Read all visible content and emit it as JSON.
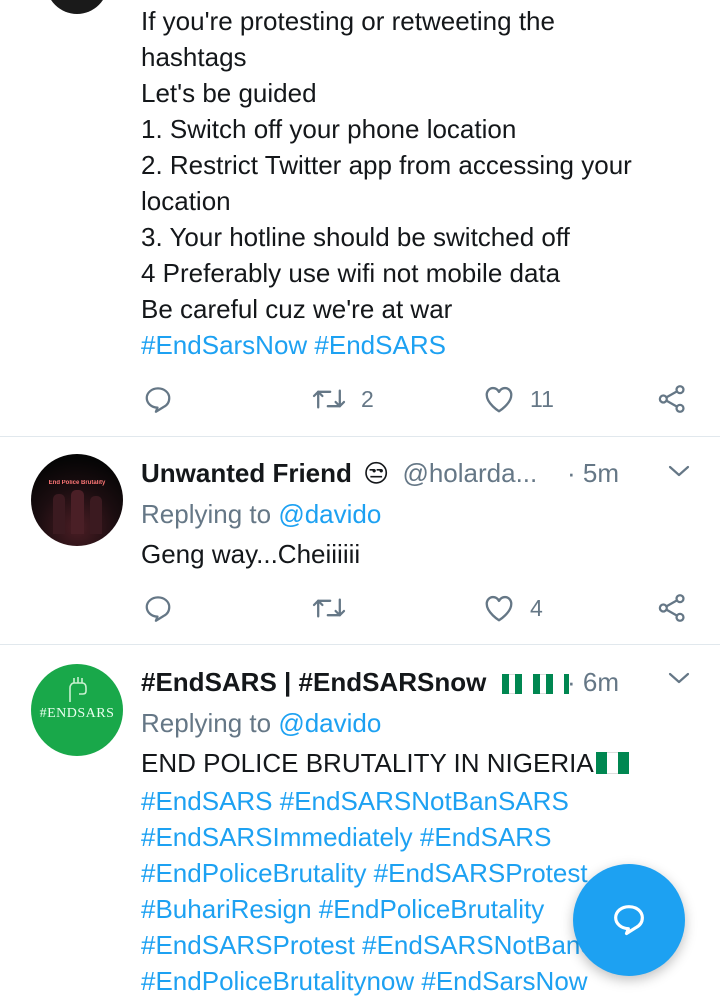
{
  "tweet1": {
    "lines": [
      "If you're protesting or retweeting the",
      "hashtags",
      "Let's be guided",
      "1. Switch off your phone location",
      "2. Restrict Twitter app from accessing your",
      "location",
      "3. Your hotline should be switched off",
      "4 Preferably use wifi not mobile data",
      "Be careful cuz we're at war"
    ],
    "hashtags": "#EndSarsNow #EndSARS",
    "retweets": "2",
    "likes": "11"
  },
  "tweet2": {
    "display_name": "Unwanted Friend",
    "emoji": "😒",
    "username": "@holarda...",
    "time": "· 5m",
    "replying_prefix": "Replying to",
    "replying_handle": "@davido",
    "text": "Geng way...Cheiiiiii",
    "retweets": "",
    "likes": "4",
    "avatar_text": "End Police Brutality"
  },
  "tweet3": {
    "display_name": "#EndSARS | #EndSARSnow",
    "time": "· 6m",
    "replying_prefix": "Replying to",
    "replying_handle": "@davido",
    "text": "END POLICE BRUTALITY IN NIGERIA",
    "hashtag_lines": [
      "#EndSARS #EndSARSNotBanSARS",
      "#EndSARSImmediately #EndSARS",
      "#EndPoliceBrutality #EndSARSProtest",
      "#BuhariResign #EndPoliceBrutality",
      "#EndSARSProtest #EndSARSNotBanSARS",
      "#EndPoliceBrutalitynow #EndSarsNow"
    ],
    "avatar_text": "#ENDSARS"
  },
  "colors": {
    "link": "#1da1f2",
    "secondary": "#657786",
    "divider": "#e1e8ed",
    "nigeria_green": "#008751",
    "avatar_green": "#19a84a"
  },
  "icons": {
    "reply": "reply-icon",
    "retweet": "retweet-icon",
    "like": "heart-icon",
    "share": "share-icon",
    "menu": "chevron-down-icon",
    "compose": "compose-reply-icon"
  }
}
